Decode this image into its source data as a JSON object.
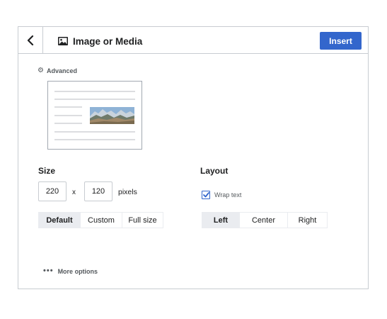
{
  "dialog": {
    "title": "Image or Media",
    "insert_label": "Insert",
    "back_icon": "chevron-left-icon",
    "title_icon": "image-icon"
  },
  "advanced": {
    "label": "Advanced",
    "icon": "gear-icon"
  },
  "size": {
    "title": "Size",
    "width": "220",
    "height": "120",
    "separator": "x",
    "unit": "pixels",
    "options": [
      "Default",
      "Custom",
      "Full size"
    ],
    "selected": "Default"
  },
  "layout": {
    "title": "Layout",
    "wrap_text_label": "Wrap text",
    "wrap_text_checked": true,
    "options": [
      "Left",
      "Center",
      "Right"
    ],
    "selected": "Left"
  },
  "more_options": {
    "label": "More options",
    "icon": "ellipsis-icon"
  },
  "colors": {
    "accent": "#3366cc",
    "border": "#c8ccd1",
    "segment_active": "#eaecf0"
  }
}
